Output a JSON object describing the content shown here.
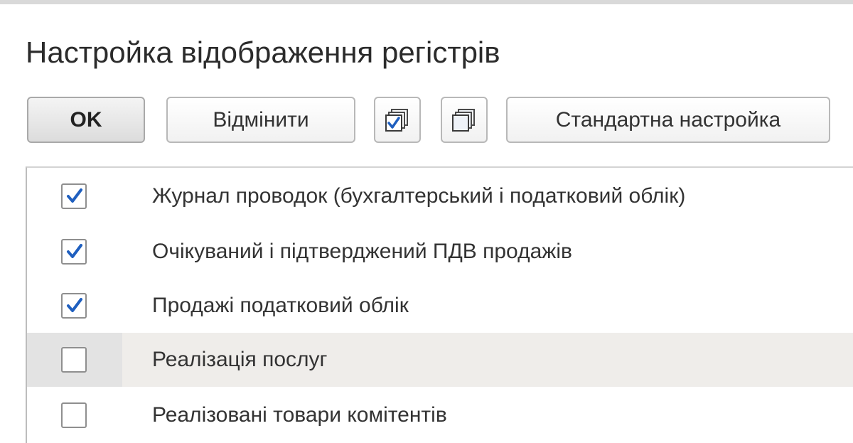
{
  "window": {
    "title": "Настройка відображення регістрів"
  },
  "toolbar": {
    "ok_label": "OK",
    "cancel_label": "Відмінити",
    "check_all_icon": "check-all-icon",
    "uncheck_all_icon": "uncheck-all-icon",
    "default_settings_label": "Стандартна настройка"
  },
  "registers": [
    {
      "label": "Журнал проводок (бухгалтерський і податковий облік)",
      "checked": true
    },
    {
      "label": "Очікуваний і підтверджений ПДВ продажів",
      "checked": true
    },
    {
      "label": "Продажі податковий облік",
      "checked": true
    },
    {
      "label": "Реалізація послуг",
      "checked": false,
      "selected": true
    },
    {
      "label": "Реалізовані товари комітентів",
      "checked": false
    }
  ],
  "colors": {
    "checkmark": "#1f5fbf",
    "selected_row": "#efedea"
  }
}
